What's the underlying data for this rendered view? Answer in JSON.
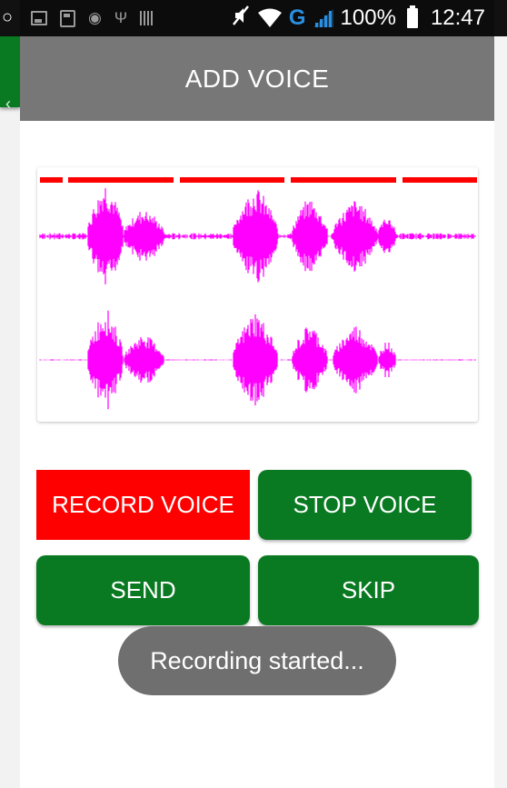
{
  "status_bar": {
    "battery_percent": "100%",
    "time": "12:47",
    "network_type": "G",
    "icons": [
      "image-icon",
      "sd-card-icon",
      "eye-icon",
      "usb-icon",
      "barcode-icon",
      "mute-icon",
      "wifi-icon",
      "signal-icon",
      "battery-icon"
    ]
  },
  "action_bar": {
    "title": "ADD VOICE"
  },
  "waveform": {
    "color": "#ff00ff",
    "marker_color": "#ff0000",
    "channels": 2
  },
  "buttons": {
    "record_label": "RECORD VOICE",
    "stop_label": "STOP VOICE",
    "send_label": "SEND",
    "skip_label": "SKIP",
    "record_color": "#ff0000",
    "primary_color": "#0a7a22"
  },
  "toast": {
    "message": "Recording started..."
  }
}
